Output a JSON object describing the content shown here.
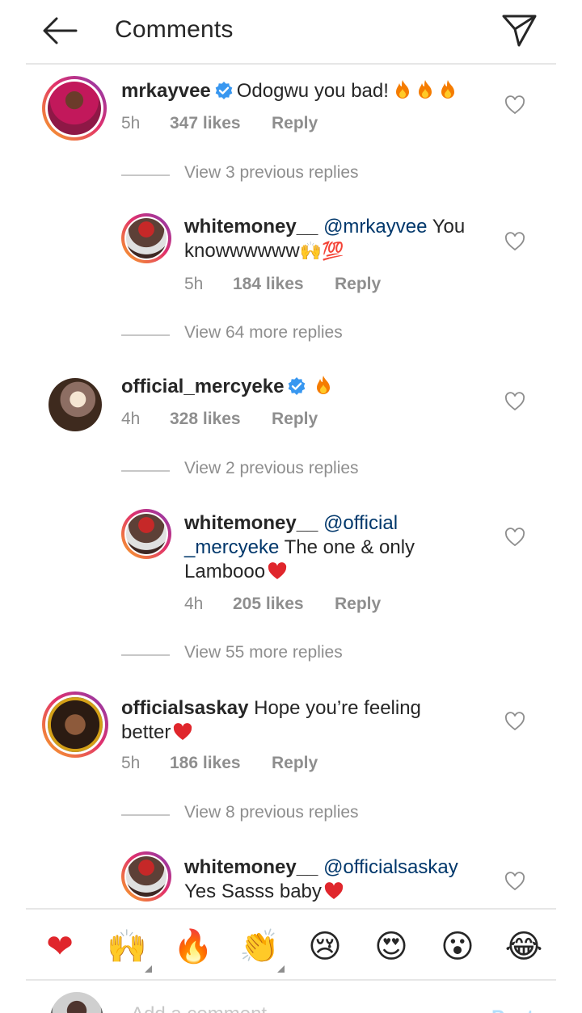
{
  "header": {
    "title": "Comments"
  },
  "comments": [
    {
      "user": "mrkayvee",
      "verified": true,
      "text": "Odogwu you bad!",
      "trailing": "fire-fire-fire",
      "time": "5h",
      "likes": "347 likes",
      "reply": "Reply",
      "view_replies": "View 3 previous replies"
    },
    {
      "user": "whitemoney__",
      "mention": "@mrkayvee",
      "text1": " You",
      "text2": "knowwwwww",
      "emoji": "🙌💯",
      "time": "5h",
      "likes": "184 likes",
      "reply": "Reply",
      "view_replies": "View 64 more replies"
    },
    {
      "user": "official_mercyeke",
      "verified": true,
      "trailing": "fire",
      "time": "4h",
      "likes": "328 likes",
      "reply": "Reply",
      "view_replies": "View 2 previous replies"
    },
    {
      "user": "whitemoney__",
      "mention1": "@official",
      "mention2": "_mercyeke",
      "text1": " The one & only",
      "text2": "Lambooo",
      "trailing": "red-heart",
      "time": "4h",
      "likes": "205 likes",
      "reply": "Reply",
      "view_replies": "View 55 more replies"
    },
    {
      "user": "officialsaskay",
      "text1": " Hope you’re feeling",
      "text2": "better",
      "trailing": "red-heart",
      "time": "5h",
      "likes": "186 likes",
      "reply": "Reply",
      "view_replies": "View 8 previous replies"
    },
    {
      "user": "whitemoney__",
      "mention": "@officialsaskay",
      "text2": "Yes Sasss baby",
      "trailing": "red-heart"
    }
  ],
  "reactions": [
    {
      "icon": "red-heart",
      "glyph": "❤"
    },
    {
      "icon": "raising-hands",
      "glyph": "🙌"
    },
    {
      "icon": "fire",
      "glyph": "🔥"
    },
    {
      "icon": "clapping-hands",
      "glyph": "👏"
    },
    {
      "icon": "crying-face",
      "glyph": "😢"
    },
    {
      "icon": "heart-eyes-face",
      "glyph": "😍"
    },
    {
      "icon": "surprised-face",
      "glyph": "😮"
    },
    {
      "icon": "tears-of-joy-face",
      "glyph": "😂"
    }
  ],
  "composer": {
    "placeholder": "Add a comment...",
    "post_label": "Post"
  },
  "colors": {
    "text": "#262626",
    "muted": "#8e8e8e",
    "mention": "#00376b",
    "verified": "#3897f0",
    "heart": "#e0262c"
  }
}
